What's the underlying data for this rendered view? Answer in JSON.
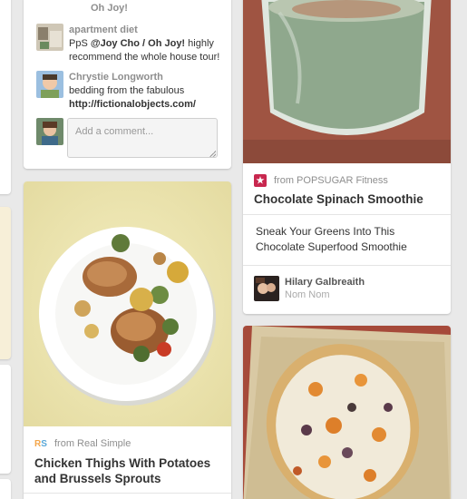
{
  "comments": [
    {
      "author": "apartment diet",
      "pre": "PpS ",
      "mention": "@Joy Cho / Oh Joy!",
      "post": " highly recommend the whole house tour!"
    },
    {
      "author": "Chrystie Longworth",
      "pre": "bedding from the fabulous",
      "link": "http://fictionalobjects.com/"
    }
  ],
  "prev_comment_tail": "Oh Joy!",
  "comment_input": {
    "placeholder": "Add a comment..."
  },
  "pins": [
    {
      "source": "from POPSUGAR Fitness",
      "title": "Chocolate Spinach Smoothie",
      "description": "Sneak Your Greens Into This Chocolate Superfood Smoothie",
      "pinner": "Hilary Galbreaith",
      "board": "Nom Nom",
      "image": "green-smoothie-photo"
    },
    {
      "source": "from Real Simple",
      "badge_text": "RS",
      "title": "Chicken Thighs With Potatoes and Brussels Sprouts",
      "image": "chicken-plate-photo"
    },
    {
      "image": "flatbread-pizza-photo"
    }
  ],
  "colors": {
    "popsugar_badge": "#c8274f",
    "rs_r": "#f4a64a",
    "rs_s": "#5aa8d8"
  }
}
